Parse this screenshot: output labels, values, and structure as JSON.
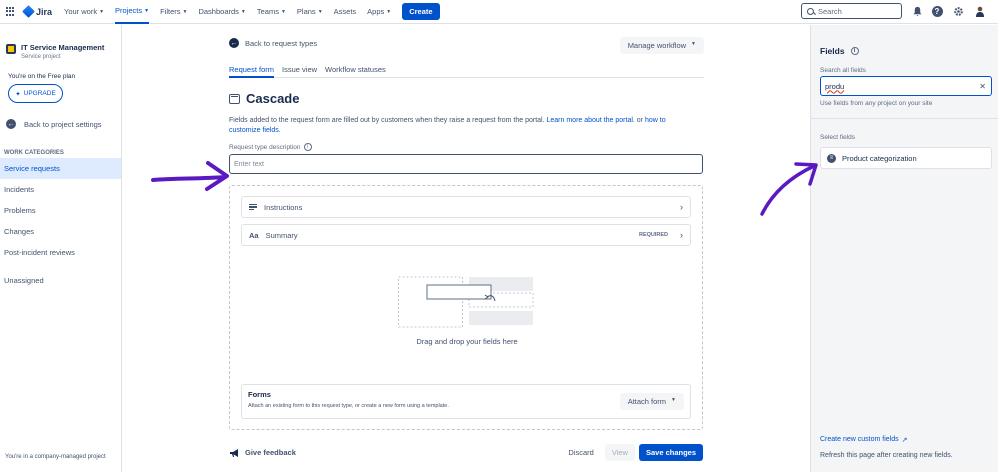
{
  "topnav": {
    "logo": "Jira",
    "items": [
      {
        "label": "Your work"
      },
      {
        "label": "Projects"
      },
      {
        "label": "Filters"
      },
      {
        "label": "Dashboards"
      },
      {
        "label": "Teams"
      },
      {
        "label": "Plans"
      },
      {
        "label": "Assets"
      },
      {
        "label": "Apps"
      }
    ],
    "create_label": "Create",
    "search_placeholder": "Search"
  },
  "sidebar": {
    "project_name": "IT Service Management",
    "project_type": "Service project",
    "free_plan": "You're on the Free plan",
    "upgrade_label": "UPGRADE",
    "back_label": "Back to project settings",
    "work_categories": "WORK CATEGORIES",
    "items": [
      {
        "label": "Service requests"
      },
      {
        "label": "Incidents"
      },
      {
        "label": "Problems"
      },
      {
        "label": "Changes"
      },
      {
        "label": "Post-incident reviews"
      }
    ],
    "unassigned": "Unassigned",
    "footer": "You're in a company-managed project"
  },
  "main": {
    "back_label": "Back to request types",
    "manage_workflow": "Manage workflow",
    "tabs": [
      {
        "label": "Request form"
      },
      {
        "label": "Issue view"
      },
      {
        "label": "Workflow statuses"
      }
    ],
    "title": "Cascade",
    "desc_text": "Fields added to the request form are filled out by customers when they raise a request from the portal. ",
    "desc_link1": "Learn more about the portal.",
    "desc_or": " or ",
    "desc_link2": "how to customize fields.",
    "field_label": "Request type description",
    "field_placeholder": "Enter text",
    "instructions": "Instructions",
    "summary": "Summary",
    "summary_icon": "Aa",
    "required": "REQUIRED",
    "drag_text": "Drag and drop your fields here",
    "forms_title": "Forms",
    "forms_sub": "Attach an existing form to this request type, or create a new form using a template.",
    "attach_form": "Attach form",
    "feedback": "Give feedback",
    "discard": "Discard",
    "view": "View",
    "save": "Save changes"
  },
  "rightpanel": {
    "title": "Fields",
    "search_label": "Search all fields",
    "search_value": "produ",
    "search_hint": "Use fields from any project on your site",
    "select_label": "Select fields",
    "field_item": "Product categorization",
    "create_link": "Create new custom fields",
    "refresh_text": "Refresh this page after creating new fields."
  },
  "colors": {
    "accent": "#0052cc",
    "annotation_arrow": "#5b19c2"
  }
}
